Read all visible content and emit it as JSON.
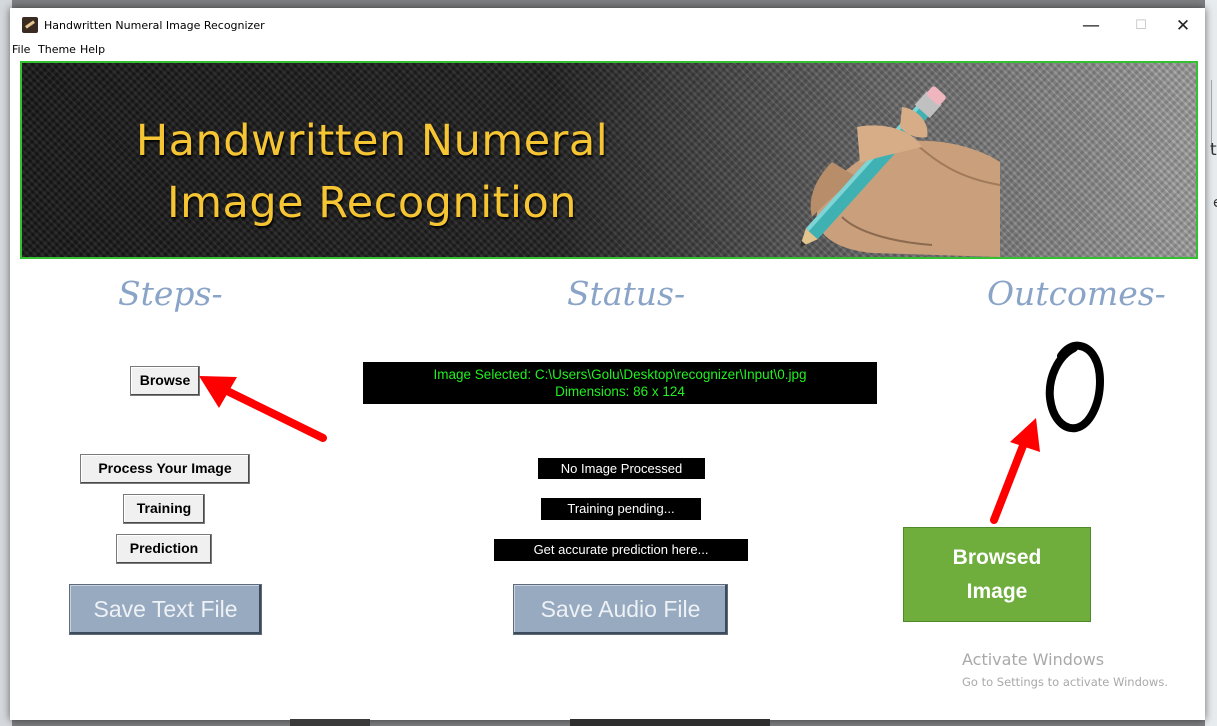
{
  "window": {
    "title": "Handwritten Numeral Image Recognizer",
    "controls": {
      "minimize": "—",
      "maximize": "☐",
      "close": "✕"
    }
  },
  "menu": [
    "File",
    "Theme",
    "Help"
  ],
  "banner": {
    "line1": "Handwritten Numeral",
    "line2": "Image Recognition",
    "title_color": "#f6c533",
    "border_color": "#35c032"
  },
  "headings": {
    "steps": "Steps-",
    "status": "Status-",
    "outcomes": "Outcomes-",
    "color": "#8aa4c8"
  },
  "steps": {
    "browse": "Browse",
    "process": "Process Your Image",
    "training": "Training",
    "prediction": "Prediction",
    "save_text": "Save Text File"
  },
  "status": {
    "selected_line1": "Image Selected: C:\\Users\\Golu\\Desktop\\recognizer\\Input\\0.jpg",
    "selected_line2": "Dimensions: 86 x 124",
    "processed": "No Image Processed",
    "training": "Training pending...",
    "prediction": "Get accurate prediction here...",
    "save_audio": "Save Audio File",
    "selected_color": "#22ef22"
  },
  "outcome": {
    "digit_icon": "handwritten-zero-image"
  },
  "annotation": {
    "callout_line1": "Browsed",
    "callout_line2": "Image",
    "callout_color": "#6fae3d",
    "arrow_color": "#ff0000"
  },
  "watermark": {
    "line1": "Activate Windows",
    "line2": "Go to Settings to activate Windows."
  }
}
